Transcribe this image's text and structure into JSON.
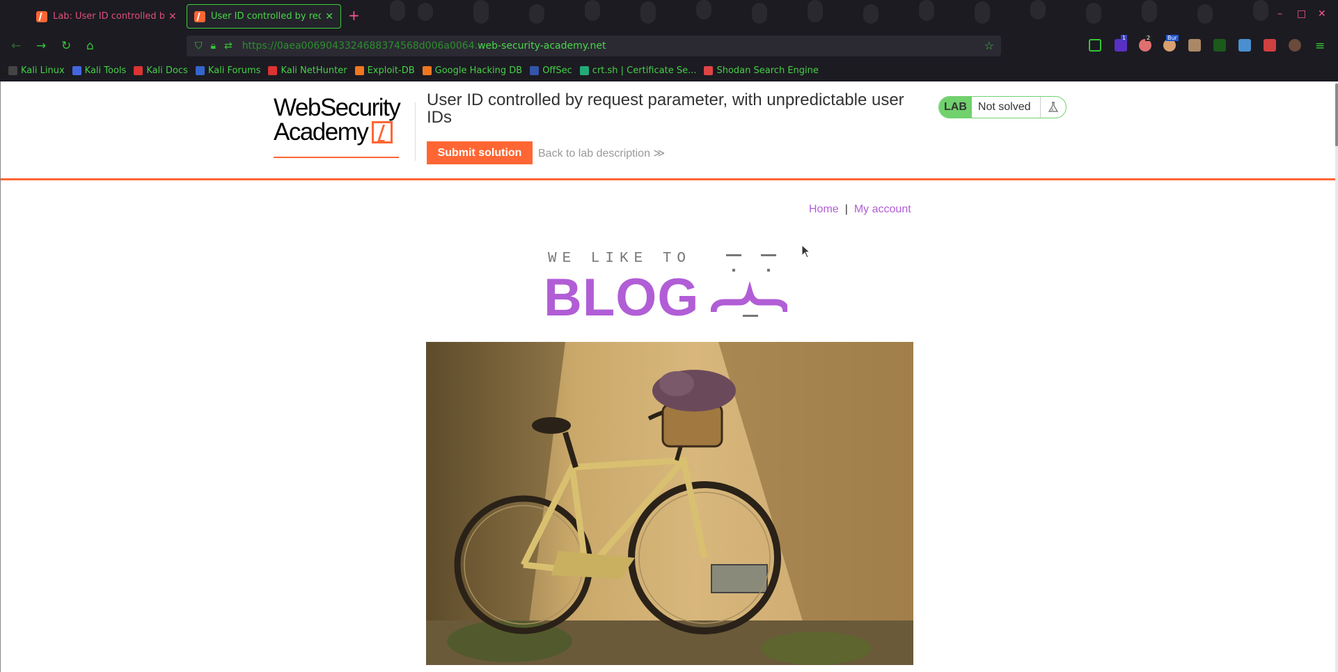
{
  "browser": {
    "tabs": [
      {
        "title": "Lab: User ID controlled by request parameter, with unpredictable user IDs",
        "active": false
      },
      {
        "title": "User ID controlled by request parameter",
        "active": true
      }
    ],
    "new_tab": "+",
    "window_controls": [
      "–",
      "□",
      "✕"
    ],
    "url_dim": "https://0aea006904332468837456 8d006a0064.",
    "url_dim_exact": "https://0aea0069043324688374568d006a0064.",
    "url_main": "web-security-academy.net",
    "extension_badges": [
      "1",
      "2",
      "Bur"
    ],
    "bookmarks": [
      {
        "label": "Kali Linux",
        "color": "#444444"
      },
      {
        "label": "Kali Tools",
        "color": "#4466dd"
      },
      {
        "label": "Kali Docs",
        "color": "#dd3333"
      },
      {
        "label": "Kali Forums",
        "color": "#3366cc"
      },
      {
        "label": "Kali NetHunter",
        "color": "#dd3333"
      },
      {
        "label": "Exploit-DB",
        "color": "#ee7722"
      },
      {
        "label": "Google Hacking DB",
        "color": "#ee7722"
      },
      {
        "label": "OffSec",
        "color": "#3355aa"
      },
      {
        "label": "crt.sh | Certificate Se...",
        "color": "#22aa77"
      },
      {
        "label": "Shodan Search Engine",
        "color": "#dd4444"
      }
    ]
  },
  "lab": {
    "logo_line1": "WebSecurity",
    "logo_line2": "Academy",
    "title": "User ID controlled by request parameter, with unpredictable user IDs",
    "submit_label": "Submit solution",
    "back_label": "Back to lab description",
    "back_chevron": "≫",
    "status_tag": "LAB",
    "status_text": "Not solved",
    "accent": "#ff6633",
    "status_color": "#70d16d"
  },
  "site": {
    "nav_home": "Home",
    "nav_sep": "|",
    "nav_account": "My account",
    "blog_tagline": "WE LIKE TO",
    "blog_wordmark": "BLOG",
    "link_color": "#b15ed6"
  },
  "icons": [
    "back-arrow-icon",
    "forward-arrow-icon",
    "reload-icon",
    "home-icon",
    "shield-icon",
    "lock-icon",
    "permissions-icon",
    "bookmark-star-icon",
    "pocket-icon",
    "menu-icon",
    "flask-icon",
    "cursor-icon"
  ]
}
